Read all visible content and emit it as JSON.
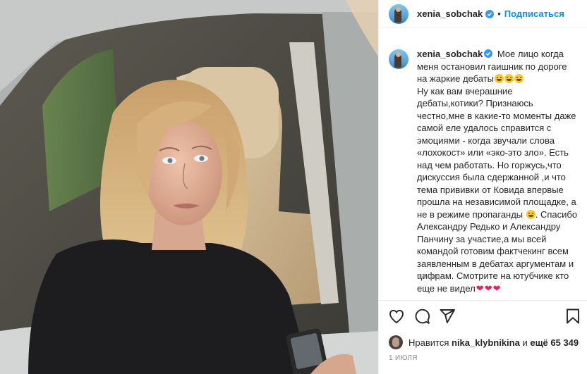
{
  "header": {
    "username": "xenia_sobchak",
    "separator": "•",
    "follow_label": "Подписаться"
  },
  "caption": {
    "username": "xenia_sobchak",
    "text_1": "Мое лицо когда меня остановил гаишник по дороге на жаркие дебаты",
    "text_2": "Ну как вам вчерашние дебаты,котики? Признаюсь честно,мне в какие-то моменты даже самой еле удалось справится с эмоциями - когда звучали слова «лохокост» или «эко-это зло». Есть над чем работать. Но горжусь,что дискуссия была сдержанной ,и что тема прививки от Ковида впервые прошла на независимой площадке, а не в режиме пропаганды",
    "text_3": ". Спасибо Александру Редько и Александру Панчину за участие,а мы всей командой готовим фактчекинг всем заявленным в дебатах аргументам и цифрам. Смотрите на ютубчике кто еще не видел"
  },
  "time_ago": "14 нед.",
  "likes": {
    "prefix": "Нравится",
    "user": "nika_klybnikina",
    "and": "и",
    "count_text": "ещё 65 349"
  },
  "date": "1 ИЮЛЯ",
  "icons": {
    "like": "heart-outline-icon",
    "comment": "comment-icon",
    "share": "paper-plane-icon",
    "save": "bookmark-icon",
    "verified": "verified-badge-icon"
  },
  "colors": {
    "accent": "#0095f6",
    "verified": "#3897f0",
    "text": "#262626",
    "muted": "#8e8e8e"
  }
}
